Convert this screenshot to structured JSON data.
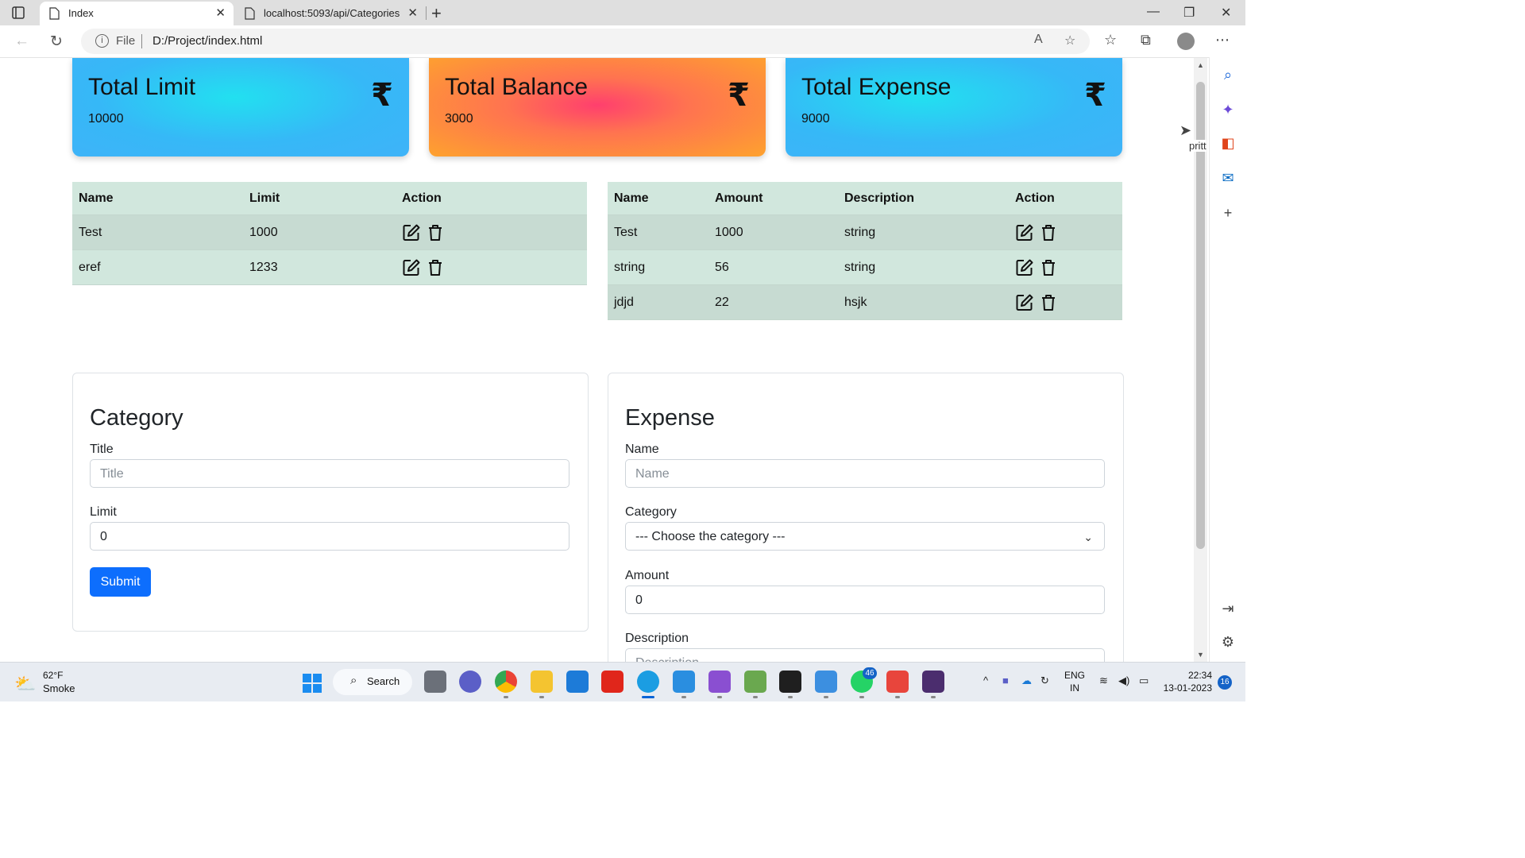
{
  "browser": {
    "tabs": [
      {
        "title": "Index",
        "active": true
      },
      {
        "title": "localhost:5093/api/Categories",
        "active": false
      }
    ],
    "address": {
      "scheme_label": "File",
      "url": "D:/Project/index.html"
    },
    "sidebar_tooltip": "pritt"
  },
  "cards": [
    {
      "title": "Total Limit",
      "value": "10000",
      "currency": "₹"
    },
    {
      "title": "Total Balance",
      "value": "3000",
      "currency": "₹"
    },
    {
      "title": "Total Expense",
      "value": "9000",
      "currency": "₹"
    }
  ],
  "category_table": {
    "headers": [
      "Name",
      "Limit",
      "Action"
    ],
    "rows": [
      {
        "name": "Test",
        "limit": "1000"
      },
      {
        "name": "eref",
        "limit": "1233"
      }
    ]
  },
  "expense_table": {
    "headers": [
      "Name",
      "Amount",
      "Description",
      "Action"
    ],
    "rows": [
      {
        "name": "Test",
        "amount": "1000",
        "description": "string"
      },
      {
        "name": "string",
        "amount": "56",
        "description": "string"
      },
      {
        "name": "jdjd",
        "amount": "22",
        "description": "hsjk"
      }
    ]
  },
  "category_form": {
    "heading": "Category",
    "title_label": "Title",
    "title_placeholder": "Title",
    "limit_label": "Limit",
    "limit_value": "0",
    "submit_label": "Submit"
  },
  "expense_form": {
    "heading": "Expense",
    "name_label": "Name",
    "name_placeholder": "Name",
    "category_label": "Category",
    "category_selected": "--- Choose the category ---",
    "amount_label": "Amount",
    "amount_value": "0",
    "description_label": "Description",
    "description_placeholder": "Description"
  },
  "taskbar": {
    "weather_temp": "62°F",
    "weather_desc": "Smoke",
    "search_label": "Search",
    "whatsapp_badge": "46",
    "lang_line1": "ENG",
    "lang_line2": "IN",
    "time": "22:34",
    "date": "13-01-2023",
    "notifications": "16"
  },
  "colors": {
    "table_header": "#d1e7dd",
    "primary_button": "#0d6efd",
    "card_blue": "#3fb3f8",
    "card_orange": "#fea22e"
  }
}
